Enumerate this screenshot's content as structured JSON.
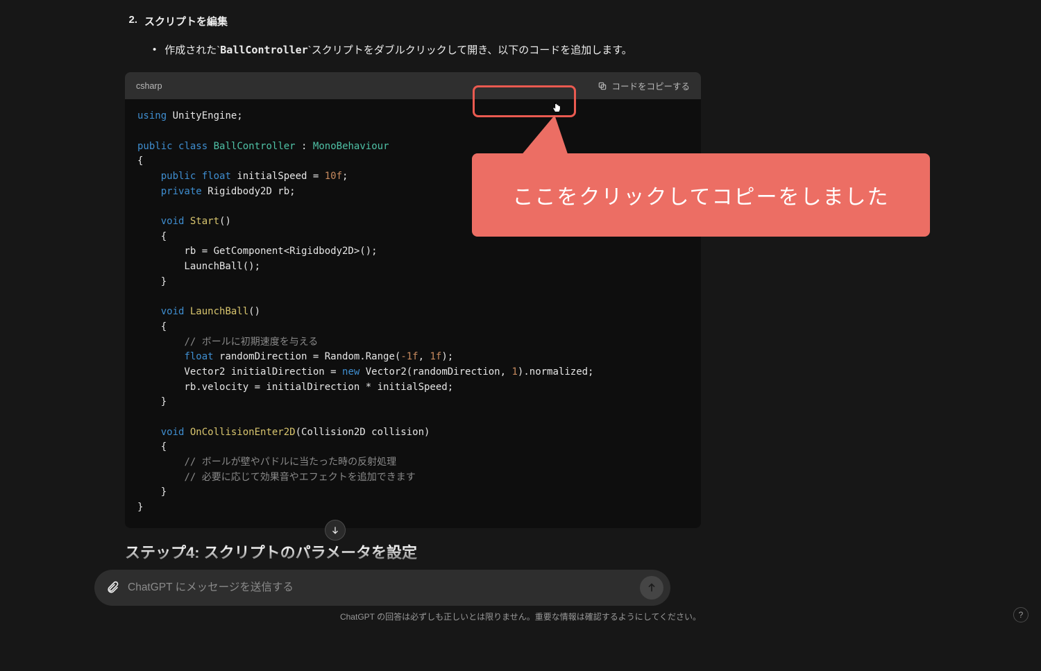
{
  "step": {
    "number": "2.",
    "title": "スクリプトを編集"
  },
  "bullet": {
    "prefix": "作成された`",
    "code": "BallController",
    "suffix": "`スクリプトをダブルクリックして開き、以下のコードを追加します。"
  },
  "codeblock": {
    "lang": "csharp",
    "copy_label": "コードをコピーする"
  },
  "code": {
    "l1_kw": "using",
    "l1_rest": " UnityEngine;",
    "l3_kw1": "public",
    "l3_kw2": "class",
    "l3_cls": "BallController",
    "l3_rest": " : ",
    "l3_base": "MonoBehaviour",
    "l4": "{",
    "l5_ind": "    ",
    "l5_kw1": "public",
    "l5_kw2": "float",
    "l5_rest": " initialSpeed = ",
    "l5_num": "10f",
    "l5_semi": ";",
    "l6_ind": "    ",
    "l6_kw": "private",
    "l6_rest": " Rigidbody2D rb;",
    "l8_ind": "    ",
    "l8_kw": "void",
    "l8_fn": "Start",
    "l8_rest": "()",
    "l9_ind": "    {",
    "l10_ind": "        rb = GetComponent<Rigidbody2D>();",
    "l11_ind": "        LaunchBall();",
    "l12_ind": "    }",
    "l14_ind": "    ",
    "l14_kw": "void",
    "l14_fn": "LaunchBall",
    "l14_rest": "()",
    "l15_ind": "    {",
    "l16_ind": "        ",
    "l16_cm": "// ボールに初期速度を与える",
    "l17_ind": "        ",
    "l17_kw": "float",
    "l17_rest": " randomDirection = Random.Range(",
    "l17_n1": "-1f",
    "l17_c": ", ",
    "l17_n2": "1f",
    "l17_end": ");",
    "l18_ind": "        Vector2 initialDirection = ",
    "l18_new": "new",
    "l18_rest": " Vector2(randomDirection, ",
    "l18_n": "1",
    "l18_end": ").normalized;",
    "l19_ind": "        rb.velocity = initialDirection * initialSpeed;",
    "l20_ind": "    }",
    "l22_ind": "    ",
    "l22_kw": "void",
    "l22_fn": "OnCollisionEnter2D",
    "l22_rest": "(Collision2D collision)",
    "l23_ind": "    {",
    "l24_ind": "        ",
    "l24_cm": "// ボールが壁やパドルに当たった時の反射処理",
    "l25_ind": "        ",
    "l25_cm": "// 必要に応じて効果音やエフェクトを追加できます",
    "l26_ind": "    }",
    "l27": "}"
  },
  "next_heading": "ステップ4: スクリプトのパラメータを設定",
  "annotation": {
    "callout": "ここをクリックしてコピーをしました"
  },
  "input": {
    "placeholder": "ChatGPT にメッセージを送信する"
  },
  "disclaimer": "ChatGPT の回答は必ずしも正しいとは限りません。重要な情報は確認するようにしてください。",
  "help": "?"
}
